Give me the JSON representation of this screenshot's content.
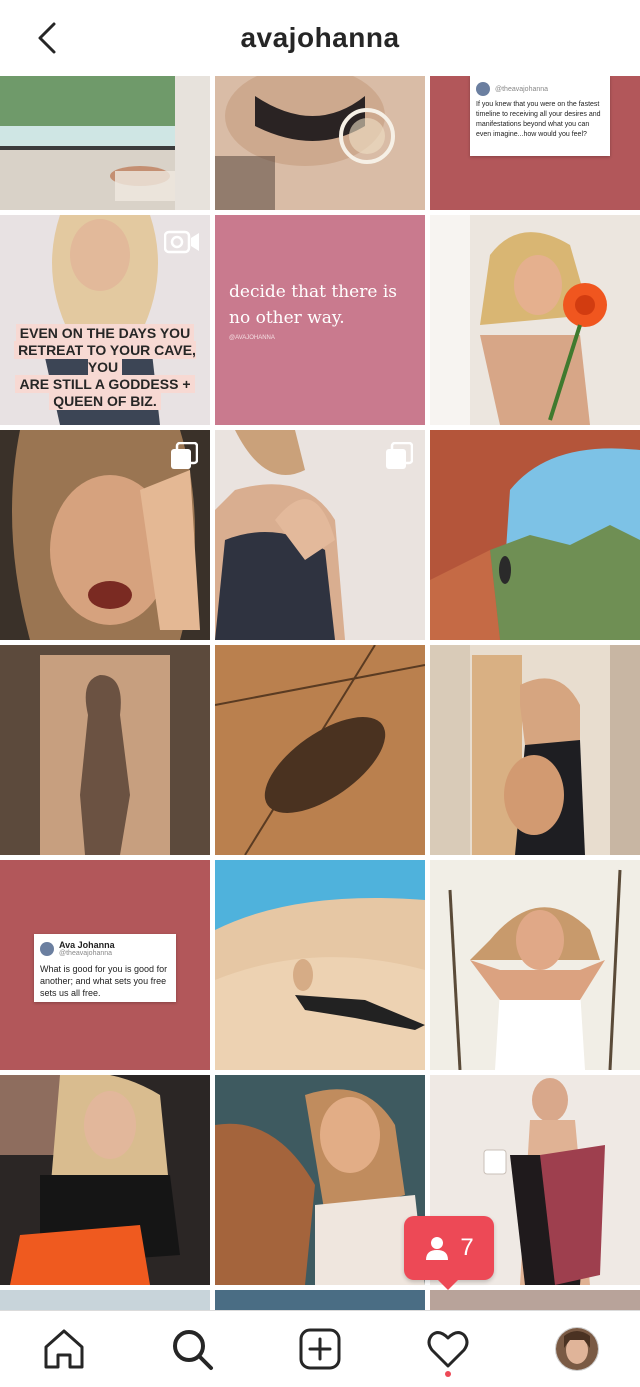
{
  "header": {
    "username": "avajohanna",
    "back_icon": "chevron-left-icon"
  },
  "posts": {
    "quote1": {
      "handle": "@theavajohanna",
      "text": "If you knew that you were on the fastest timeline to receiving all your desires and manifestations beyond what you can even imagine...how would you feel?"
    },
    "caption_lines": [
      "EVEN ON THE DAYS YOU",
      "RETREAT TO YOUR CAVE, YOU",
      "ARE STILL A GODDESS +",
      "QUEEN OF BIZ."
    ],
    "script_quote": "decide that there is no other way.",
    "script_handle": "@AVAJOHANNA",
    "quote2": {
      "name": "Ava Johanna",
      "handle": "@theavajohanna",
      "text": "What is good for you is good for another; and what sets you free sets us all free."
    }
  },
  "notification": {
    "icon": "follower-icon",
    "count": "7",
    "color": "#ed4956"
  },
  "tabbar": {
    "items": [
      "home-icon",
      "search-icon",
      "new-post-icon",
      "activity-heart-icon",
      "profile-avatar"
    ]
  },
  "colors": {
    "text": "#262626",
    "brick_red": "#b2575a",
    "dusty_pink": "#c97a8e"
  }
}
